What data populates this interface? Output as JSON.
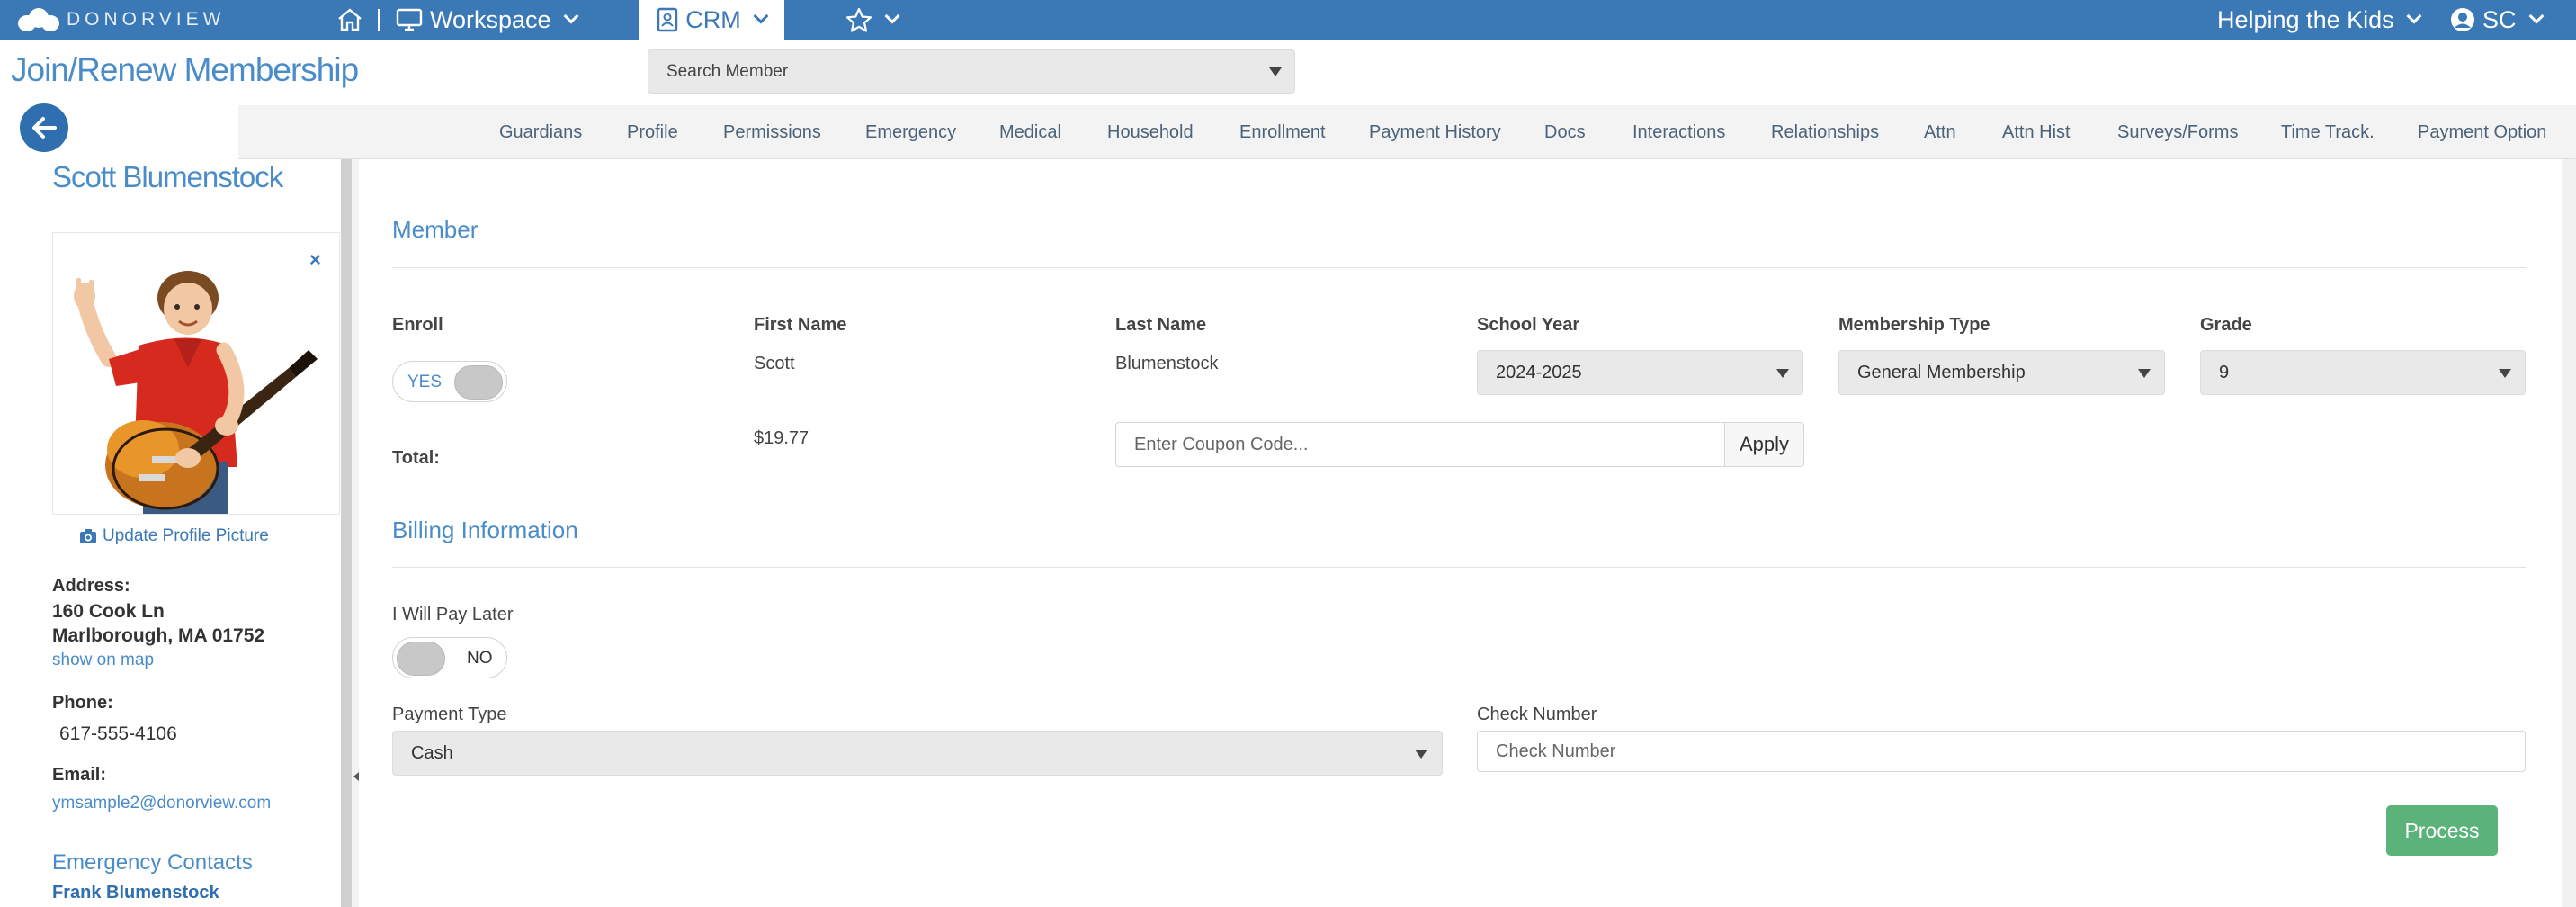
{
  "app": {
    "logo_text": "DONORVIEW",
    "workspace_label": "Workspace",
    "crm_label": "CRM",
    "org_label": "Helping the Kids",
    "user_initials": "SC"
  },
  "header": {
    "page_title": "Join/Renew Membership",
    "search_placeholder": "Search Member"
  },
  "tabs": [
    "Guardians",
    "Profile",
    "Permissions",
    "Emergency",
    "Medical",
    "Household",
    "Enrollment",
    "Payment History",
    "Docs",
    "Interactions",
    "Relationships",
    "Attn",
    "Attn Hist",
    "Surveys/Forms",
    "Time Track.",
    "Payment Option"
  ],
  "sidebar": {
    "name": "Scott Blumenstock",
    "close_symbol": "×",
    "update_picture": "Update Profile Picture",
    "address_label": "Address:",
    "address_line1": "160 Cook Ln",
    "address_line2": "Marlborough, MA 01752",
    "show_on_map": "show on map",
    "phone_label": "Phone:",
    "phone": "617-555-4106",
    "email_label": "Email:",
    "email": "ymsample2@donorview.com",
    "emergency_title": "Emergency Contacts",
    "emergency_contact": "Frank Blumenstock"
  },
  "member": {
    "section_title": "Member",
    "enroll_label": "Enroll",
    "enroll_toggle": "YES",
    "first_name_label": "First Name",
    "first_name": "Scott",
    "last_name_label": "Last Name",
    "last_name": "Blumenstock",
    "school_year_label": "School Year",
    "school_year": "2024-2025",
    "membership_type_label": "Membership Type",
    "membership_type": "General Membership",
    "grade_label": "Grade",
    "grade": "9",
    "total_label": "Total:",
    "total": "$19.77",
    "coupon_placeholder": "Enter Coupon Code...",
    "apply_label": "Apply"
  },
  "billing": {
    "section_title": "Billing Information",
    "pay_later_label": "I Will Pay Later",
    "pay_later_toggle": "NO",
    "payment_type_label": "Payment Type",
    "payment_type": "Cash",
    "check_number_label": "Check Number",
    "check_number_placeholder": "Check Number",
    "process_label": "Process"
  },
  "colors": {
    "brand_blue": "#3a78b6",
    "link_blue": "#4a8cc9",
    "process_green": "#5cb37a"
  }
}
